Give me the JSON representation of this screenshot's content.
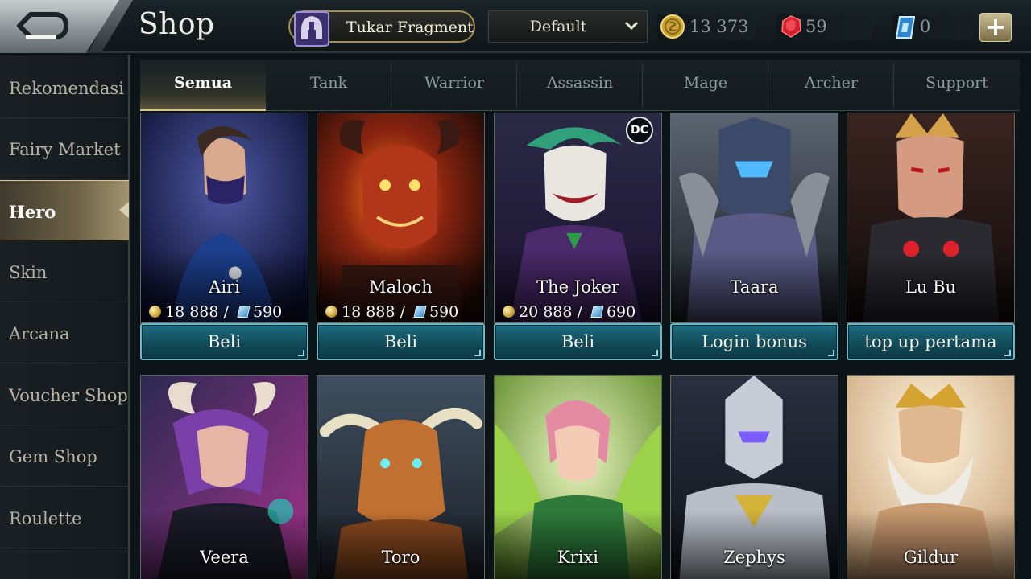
{
  "header": {
    "title": "Shop",
    "exchange_label": "Tukar Fragment",
    "preset_label": "Default",
    "gold": "13 373",
    "gems": "59",
    "vouchers": "0"
  },
  "sidebar": {
    "items": [
      {
        "label": "Rekomendasi"
      },
      {
        "label": "Fairy Market"
      },
      {
        "label": "Hero",
        "active": true
      },
      {
        "label": "Skin"
      },
      {
        "label": "Arcana"
      },
      {
        "label": "Voucher Shop"
      },
      {
        "label": "Gem Shop"
      },
      {
        "label": "Roulette"
      }
    ]
  },
  "tabs": [
    {
      "label": "Semua",
      "active": true
    },
    {
      "label": "Tank"
    },
    {
      "label": "Warrior"
    },
    {
      "label": "Assassin"
    },
    {
      "label": "Mage"
    },
    {
      "label": "Archer"
    },
    {
      "label": "Support"
    }
  ],
  "heroes_row1": [
    {
      "name": "Airi",
      "gold": "18 888 /",
      "voucher": "590",
      "button": "Beli"
    },
    {
      "name": "Maloch",
      "gold": "18 888 /",
      "voucher": "590",
      "button": "Beli"
    },
    {
      "name": "The Joker",
      "gold": "20 888 /",
      "voucher": "690",
      "button": "Beli",
      "badge": "DC"
    },
    {
      "name": "Taara",
      "button": "Login bonus"
    },
    {
      "name": "Lu Bu",
      "button": "top up pertama"
    }
  ],
  "heroes_row2": [
    {
      "name": "Veera"
    },
    {
      "name": "Toro"
    },
    {
      "name": "Krixi"
    },
    {
      "name": "Zephys"
    },
    {
      "name": "Gildur"
    }
  ],
  "colors": {
    "accent_gold": "#d5c38e",
    "buy_button": "#1d6f82",
    "active_sidebar": "#6e6347"
  },
  "icons": {
    "back": "back-arrow-icon",
    "exchange": "helmet-icon",
    "dropdown": "chevron-down-icon",
    "gold": "gold-coin-icon",
    "gem": "ruby-gem-icon",
    "voucher": "voucher-icon",
    "add": "plus-icon"
  }
}
